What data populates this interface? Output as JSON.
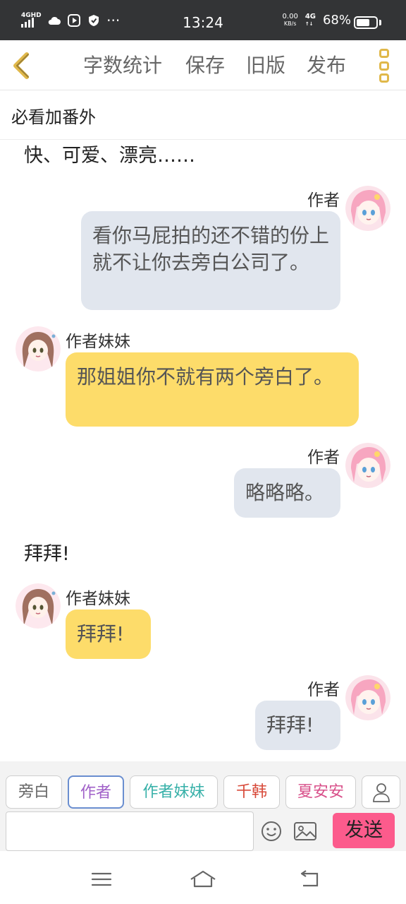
{
  "status_bar": {
    "network": "4GHD",
    "time": "13:24",
    "speed_value": "0.00",
    "speed_unit": "KB/s",
    "mobile": "4G",
    "battery": "68%",
    "battery_level": 0.68
  },
  "header": {
    "back_icon": "chevron-left-icon",
    "menu": [
      "字数统计",
      "保存",
      "旧版",
      "发布"
    ],
    "more_icon": "more-vertical-icon"
  },
  "title": "必看加番外",
  "messages": {
    "narration_top": "快、可爱、漂亮……",
    "m1_name": "作者",
    "m1_text": "看你马屁拍的还不错的份上就不让你去旁白公司了。",
    "m2_name": "作者妹妹",
    "m2_text": "那姐姐你不就有两个旁白了。",
    "m3_name": "作者",
    "m3_text": "略略略。",
    "narration_mid": "拜拜!",
    "m4_name": "作者妹妹",
    "m4_text": "拜拜!",
    "m5_name": "作者",
    "m5_text": "拜拜!"
  },
  "roles": {
    "narrator": "旁白",
    "author": "作者",
    "sister": "作者妹妹",
    "qianhan": "千韩",
    "xiaanan": "夏安安"
  },
  "colors": {
    "author_bubble": "#e1e6ee",
    "sister_bubble": "#fddc6a",
    "send_button": "#fc5b8c",
    "accent_author": "#a060c8",
    "accent_sister": "#36b0a8",
    "accent_qianhan": "#d84a3a",
    "accent_xiaanan": "#d8508a"
  },
  "input": {
    "value": "",
    "placeholder": "",
    "send": "发送",
    "emoji_icon": "smiley-icon",
    "image_icon": "image-icon",
    "person_icon": "person-icon"
  },
  "nav": {
    "menu_icon": "menu-icon",
    "home_icon": "home-icon",
    "back_icon": "back-icon"
  }
}
